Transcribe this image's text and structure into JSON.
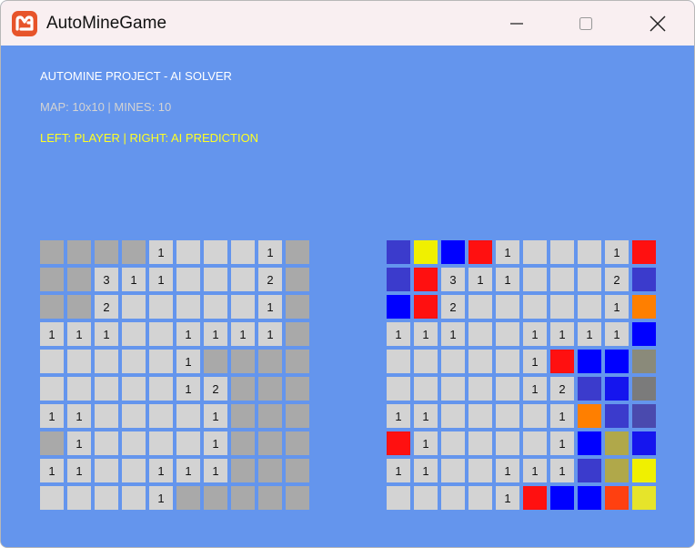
{
  "window": {
    "title": "AutoMineGame",
    "icon": "monogame-logo-icon",
    "controls": [
      "minimize-icon",
      "maximize-icon",
      "close-icon"
    ]
  },
  "info": {
    "line1": "AUTOMINE PROJECT - AI SOLVER",
    "line2": "MAP: 10x10 | MINES: 10",
    "line3": "LEFT: PLAYER | RIGHT: AI PREDICTION"
  },
  "colors": {
    "background": "#6495ED",
    "titlebar": "#F9EFF1",
    "hidden": "#A9A9A9",
    "revealed": "#D3D3D3",
    "line1": "#FFFFFF",
    "line2": "#D3D3D3",
    "line3": "#FFFF22"
  },
  "legend": {
    "H": "#A9A9A9",
    "E": "#D3D3D3",
    "B": "#0000FF",
    "b": "#3B3BCC",
    "k": "#1515EE",
    "R": "#FF1010",
    "Y": "#F0F000",
    "y": "#E6E42A",
    "O": "#FF7F00",
    "o": "#FF4010",
    "G": "#8A8A7A",
    "g": "#7B7B7B",
    "L": "#B0A84A",
    "P": "#4A4AAE"
  },
  "player_board": [
    [
      "H",
      "H",
      "H",
      "H",
      "1",
      "E",
      "E",
      "E",
      "1",
      "H"
    ],
    [
      "H",
      "H",
      "3",
      "1",
      "1",
      "E",
      "E",
      "E",
      "2",
      "H"
    ],
    [
      "H",
      "H",
      "2",
      "E",
      "E",
      "E",
      "E",
      "E",
      "1",
      "H"
    ],
    [
      "1",
      "1",
      "1",
      "E",
      "E",
      "1",
      "1",
      "1",
      "1",
      "H"
    ],
    [
      "E",
      "E",
      "E",
      "E",
      "E",
      "1",
      "H",
      "H",
      "H",
      "H"
    ],
    [
      "E",
      "E",
      "E",
      "E",
      "E",
      "1",
      "2",
      "H",
      "H",
      "H"
    ],
    [
      "1",
      "1",
      "E",
      "E",
      "E",
      "E",
      "1",
      "H",
      "H",
      "H"
    ],
    [
      "H",
      "1",
      "E",
      "E",
      "E",
      "E",
      "1",
      "H",
      "H",
      "H"
    ],
    [
      "1",
      "1",
      "E",
      "E",
      "1",
      "1",
      "1",
      "H",
      "H",
      "H"
    ],
    [
      "E",
      "E",
      "E",
      "E",
      "1",
      "H",
      "H",
      "H",
      "H",
      "H"
    ]
  ],
  "ai_board": [
    [
      "b",
      "Y",
      "B",
      "R",
      "1",
      "E",
      "E",
      "E",
      "1",
      "R"
    ],
    [
      "b",
      "R",
      "3",
      "1",
      "1",
      "E",
      "E",
      "E",
      "2",
      "b"
    ],
    [
      "B",
      "R",
      "2",
      "E",
      "E",
      "E",
      "E",
      "E",
      "1",
      "O"
    ],
    [
      "1",
      "1",
      "1",
      "E",
      "E",
      "1",
      "1",
      "1",
      "1",
      "B"
    ],
    [
      "E",
      "E",
      "E",
      "E",
      "E",
      "1",
      "R",
      "B",
      "B",
      "G"
    ],
    [
      "E",
      "E",
      "E",
      "E",
      "E",
      "1",
      "2",
      "b",
      "k",
      "g"
    ],
    [
      "1",
      "1",
      "E",
      "E",
      "E",
      "E",
      "1",
      "O",
      "b",
      "P"
    ],
    [
      "R",
      "1",
      "E",
      "E",
      "E",
      "E",
      "1",
      "B",
      "L",
      "k"
    ],
    [
      "1",
      "1",
      "E",
      "E",
      "1",
      "1",
      "1",
      "b",
      "L",
      "Y"
    ],
    [
      "E",
      "E",
      "E",
      "E",
      "1",
      "R",
      "B",
      "B",
      "o",
      "y"
    ]
  ]
}
